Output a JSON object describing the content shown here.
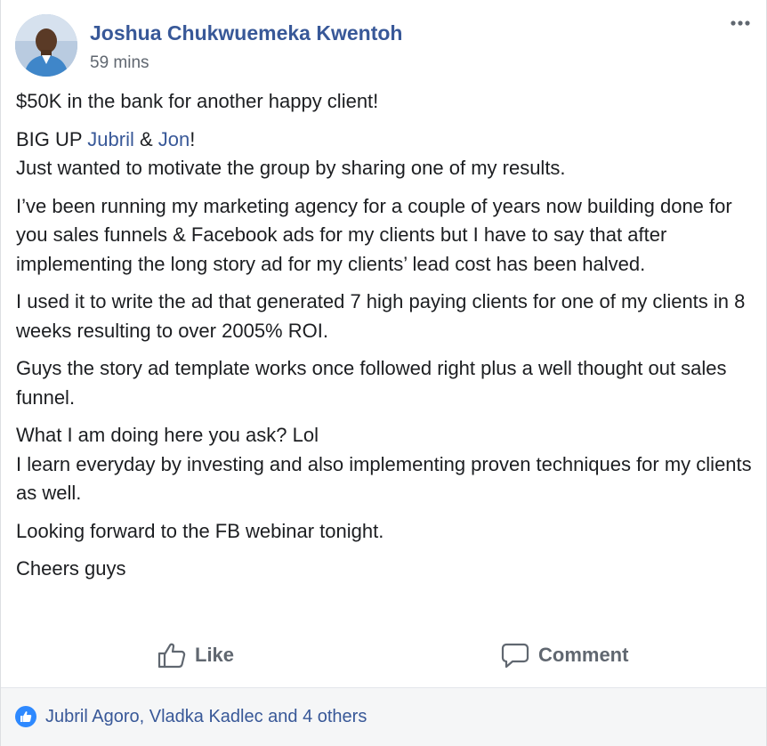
{
  "post": {
    "author": "Joshua Chukwuemeka Kwentoh",
    "timestamp": "59 mins",
    "paragraphs": {
      "p1": "$50K in the bank for another happy client!",
      "p2_prefix": "BIG UP ",
      "mention1": "Jubril",
      "p2_and": " & ",
      "mention2": "Jon",
      "p2_suffix": "!",
      "p2_line2": "Just wanted to motivate the group by sharing one of my results.",
      "p3": "I’ve been running my marketing agency for a couple of years now building done for you sales funnels & Facebook ads for my clients but I have to say that after implementing the long story ad for my clients’ lead cost has been halved.",
      "p4": "I used it to write the ad that generated 7 high paying clients for one of my clients in 8 weeks resulting to over 2005% ROI.",
      "p5": "Guys the story ad template works once followed right plus a well thought out sales funnel.",
      "p6_line1": "What I am doing here you ask? Lol",
      "p6_line2": "I learn everyday by investing and also implementing proven techniques for my clients as well.",
      "p7": "Looking forward to the FB webinar tonight.",
      "p8": "Cheers guys"
    }
  },
  "actions": {
    "like_label": "Like",
    "comment_label": "Comment"
  },
  "reactions": {
    "summary": "Jubril Agoro, Vladka Kadlec and 4 others"
  },
  "icons": {
    "avatar": "profile-photo",
    "more": "more-options-icon",
    "like": "thumbs-up-icon",
    "comment": "speech-bubble-icon",
    "reaction": "like-reaction-icon"
  },
  "colors": {
    "link": "#385898",
    "muted": "#606770",
    "text": "#1c1e21",
    "like_badge": "#2e89ff",
    "footer_bg": "#f5f6f7"
  }
}
